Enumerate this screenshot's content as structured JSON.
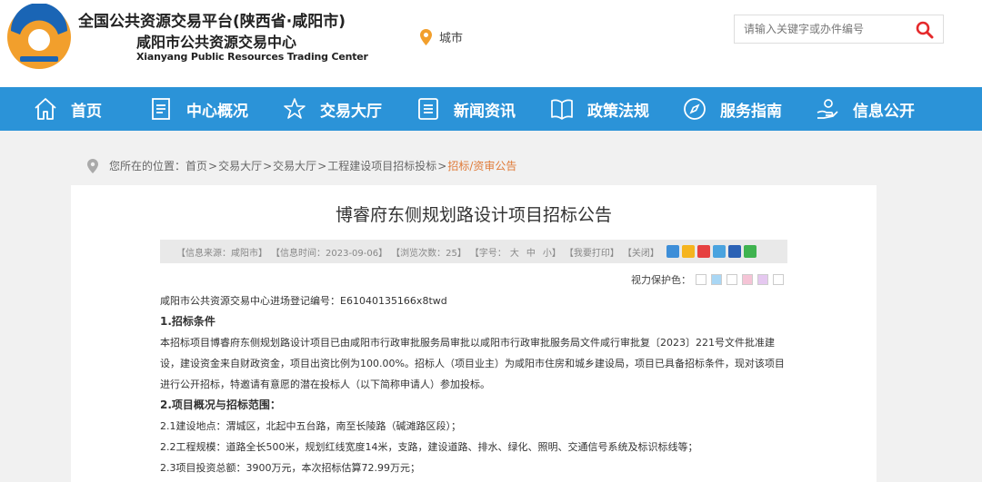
{
  "header": {
    "title": "全国公共资源交易平台(陕西省·咸阳市)",
    "subtitle": "咸阳市公共资源交易中心",
    "english": "Xianyang Public Resources Trading Center",
    "city_label": "城市",
    "search_placeholder": "请输入关键字或办件编号"
  },
  "colors": {
    "nav": "#2b93d8",
    "logo_orange": "#f29f2c",
    "logo_blue": "#1a65b5",
    "search_icon": "#e5292b",
    "current_crumb": "#e07b39"
  },
  "nav": [
    {
      "label": "首页",
      "icon": "home-icon"
    },
    {
      "label": "中心概况",
      "icon": "document-icon"
    },
    {
      "label": "交易大厅",
      "icon": "star-icon"
    },
    {
      "label": "新闻资讯",
      "icon": "list-icon"
    },
    {
      "label": "政策法规",
      "icon": "book-icon"
    },
    {
      "label": "服务指南",
      "icon": "compass-icon"
    },
    {
      "label": "信息公开",
      "icon": "hand-icon"
    }
  ],
  "breadcrumb": {
    "prefix": "您所在的位置：",
    "items": [
      "首页",
      "交易大厅",
      "交易大厅",
      "工程建设项目招标投标"
    ],
    "separator": ">",
    "current": "招标/资审公告"
  },
  "article": {
    "title": "博睿府东侧规划路设计项目招标公告",
    "meta": {
      "source": "【信息来源：咸阳市】",
      "time": "【信息时间：2023-09-06】",
      "views": "【浏览次数：25】",
      "font_label": "【字号：",
      "font_big": "大",
      "font_mid": "中",
      "font_small": "小】",
      "print": "【我要打印】",
      "close": "【关闭】"
    },
    "eye_label": "视力保护色：",
    "eye_colors": [
      "#ffffff",
      "#a9d7f5",
      "#ffffff",
      "#f5c4d6",
      "#e5c8f0",
      "#ffffff"
    ],
    "paragraphs": [
      {
        "type": "text",
        "text": "咸阳市公共资源交易中心进场登记编号：E61040135166x8twd"
      },
      {
        "type": "heading",
        "text": "1.招标条件"
      },
      {
        "type": "text",
        "text": "本招标项目博睿府东侧规划路设计项目已由咸阳市行政审批服务局审批以咸阳市行政审批服务局文件咸行审批复〔2023〕221号文件批准建设，建设资金来自财政资金，项目出资比例为100.00%。招标人（项目业主）为咸阳市住房和城乡建设局，项目已具备招标条件，现对该项目进行公开招标，特邀请有意愿的潜在投标人（以下简称申请人）参加投标。"
      },
      {
        "type": "heading",
        "text": "2.项目概况与招标范围："
      },
      {
        "type": "text",
        "text": "2.1建设地点：渭城区，北起中五台路，南至长陵路（碱滩路区段）；"
      },
      {
        "type": "text",
        "text": "2.2工程规模：道路全长500米，规划红线宽度14米，支路，建设道路、排水、绿化、照明、交通信号系统及标识标线等；"
      },
      {
        "type": "text",
        "text": "2.3项目投资总额：3900万元，本次招标估算72.99万元；"
      }
    ]
  }
}
